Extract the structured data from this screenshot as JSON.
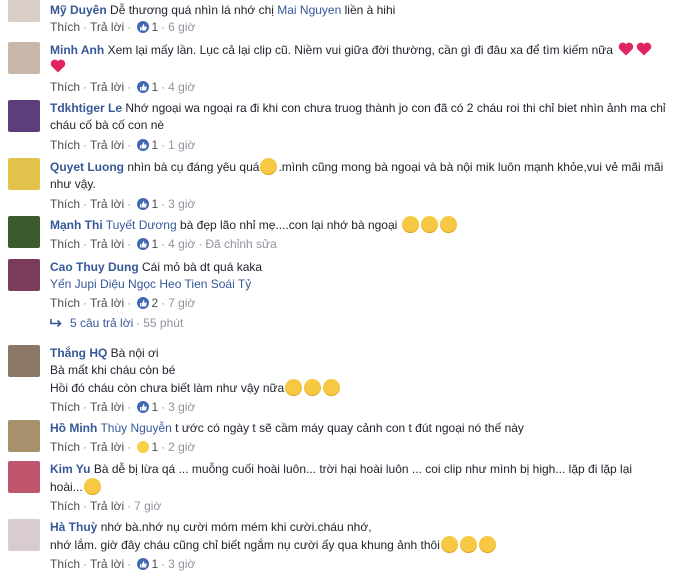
{
  "actions": {
    "like": "Thích",
    "reply": "Trả lời",
    "edited": "Đã chỉnh sửa"
  },
  "comments": [
    {
      "name": "Mỹ Duyên",
      "text": "Dễ thương quá nhìn lá nhớ chị ",
      "mention": "Mai Nguyen",
      "text2": " liền à hihi",
      "likes": "1",
      "time": "6 giờ",
      "avatar": "#d9cfc8"
    },
    {
      "name": "Minh Anh",
      "text": "Xem lại mấy lần. Lục cả lại clip cũ. Niềm vui giữa đời thường, cần gì đi đâu xa để tìm kiếm nữa",
      "likes": "1",
      "time": "4 giờ",
      "avatar": "#c9b8a9"
    },
    {
      "name": "Tdkhtiger Le",
      "text": "Nhớ ngoại wa ngoại ra đi khi con chưa truog thành jo con đã có 2 cháu roi thi chỉ biet nhìn ảnh ma chỉ cháu cố bà cố con nè",
      "likes": "1",
      "time": "1 giờ",
      "avatar": "#5b3e7a"
    },
    {
      "name": "Quyet Luong",
      "text": "nhìn bà cụ đáng yêu quá",
      "text2": ".mình cũng mong bà ngoại và bà nội mik luôn mạnh khỏe,vui vẻ mãi mãi như vậy.",
      "likes": "1",
      "time": "3 giờ",
      "avatar": "#e2c24a"
    },
    {
      "name": "Mạnh Thi",
      "mention": "Tuyết Dương",
      "text": " bà đẹp lão nhỉ mẹ....con lại nhớ bà ngoại",
      "likes": "1",
      "time": "4 giờ",
      "avatar": "#3b5a2e"
    },
    {
      "name": "Cao Thuy Dung",
      "text": "Cái mỏ bà dt quá kaka",
      "mention": "Yến Jupi Diệu Ngọc Heo Tien Soái Tỷ",
      "likes": "2",
      "time": "7 giờ",
      "avatar": "#7a3c5a"
    },
    {
      "name": "Thắng HQ",
      "text": "Bà nội ơi",
      "line2": "Bà mất khi cháu còn bé",
      "line3": "Hồi đó cháu còn chưa biết làm như vậy nữa",
      "likes": "1",
      "time": "3 giờ",
      "avatar": "#8a7766"
    },
    {
      "name": "Hồ Minh",
      "mention": "Thùy Nguyễn",
      "text": " t ước có ngày t sẽ cầm máy quay cảnh con t đút ngoại nó thế này",
      "likes": "1",
      "time": "2 giờ",
      "avatar": "#a8926d"
    },
    {
      "name": "Kim Yu",
      "text": "Bà dễ bị lừa qá ... muỗng cuối hoài luôn... trời hại hoài luôn ... coi clip như mình bị high... lặp đi lặp lại hoài...",
      "likes": "",
      "time": "7 giờ",
      "avatar": "#c0566e"
    },
    {
      "name": "Hà Thuỳ",
      "text": "nhớ bà.nhớ nụ cười móm mém khi cười.cháu nhớ,",
      "line2": "nhớ lắm. giờ đây cháu cũng chỉ biết ngắm nụ cười ấy qua khung ảnh thôi",
      "likes": "1",
      "time": "3 giờ",
      "avatar": "#d8ccd2"
    }
  ],
  "replies": {
    "label": "5 câu trả lời",
    "time": "55 phút"
  },
  "icons": {
    "like_badge": "thumbs-up-icon",
    "haha_badge": "haha-icon",
    "reply_arrow": "reply-arrow-icon"
  },
  "colors": {
    "link": "#365899",
    "meta": "#90949c",
    "like_blue": "#4267b2"
  }
}
